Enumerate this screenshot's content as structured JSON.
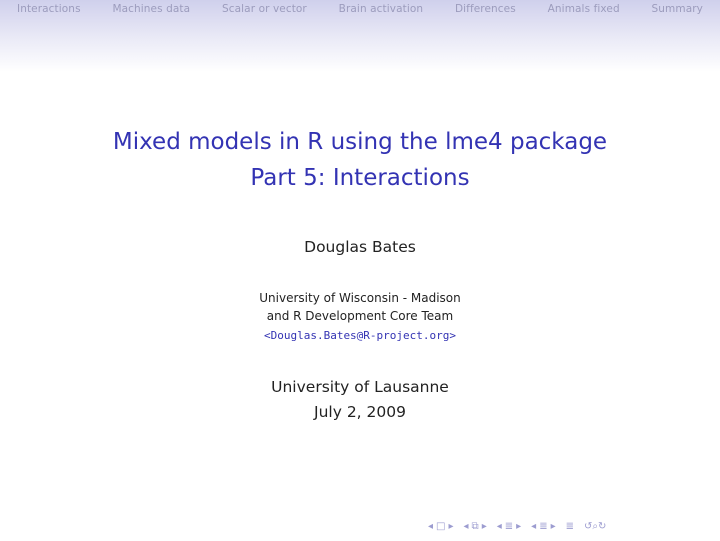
{
  "nav": {
    "items": [
      "Interactions",
      "Machines data",
      "Scalar or vector",
      "Brain activation",
      "Differences",
      "Animals fixed",
      "Summary"
    ]
  },
  "title": {
    "line1": "Mixed models in R using the lme4 package",
    "line2": "Part 5: Interactions"
  },
  "author": "Douglas Bates",
  "institution": {
    "line1": "University of Wisconsin - Madison",
    "line2": "and R Development Core Team",
    "email": "<Douglas.Bates@R-project.org>"
  },
  "venue": {
    "place": "University of Lausanne",
    "date": "July 2, 2009"
  },
  "navigation_symbols": {
    "frame_prev": "◂",
    "frame_icon": "□",
    "frame_next": "▸",
    "subsection_prev": "◂",
    "subsection_icon": "⧉",
    "subsection_next": "▸",
    "section_prev": "◂",
    "section_icon": "≣",
    "section_next": "▸",
    "sub_prev": "◂",
    "sub_icon": "≣",
    "sub_next": "▸",
    "doc_icon": "≣",
    "search_icons": "↺⌕↻"
  }
}
